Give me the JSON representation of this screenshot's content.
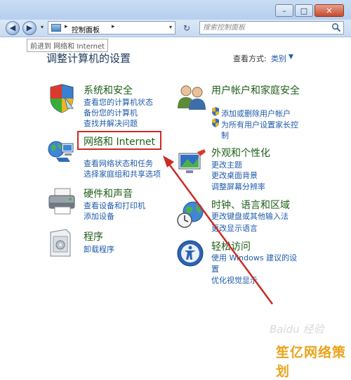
{
  "window": {
    "minimize": "–",
    "maximize": "□",
    "close": "✕"
  },
  "nav": {
    "back": "◀",
    "forward": "▶",
    "dropdown": "▾",
    "address_segment": "控制面板",
    "address_sep": "▸",
    "refresh": "↻",
    "search_placeholder": "搜索控制面板"
  },
  "tooltip": "前进到 网络和 Internet",
  "heading": "调整计算机的设置",
  "view": {
    "label": "查看方式:",
    "value": "类别",
    "arrow": "▼"
  },
  "categories": {
    "system": {
      "title": "系统和安全",
      "links": [
        "查看您的计算机状态",
        "备份您的计算机",
        "查找并解决问题"
      ]
    },
    "network": {
      "title": "网络和 Internet",
      "links": [
        "查看网络状态和任务",
        "选择家庭组和共享选项"
      ]
    },
    "hardware": {
      "title": "硬件和声音",
      "links": [
        "查看设备和打印机",
        "添加设备"
      ]
    },
    "programs": {
      "title": "程序",
      "links": [
        "卸载程序"
      ]
    },
    "users": {
      "title": "用户帐户和家庭安全",
      "links": [
        "添加或删除用户帐户",
        "为所有用户设置家长控",
        "制"
      ]
    },
    "appearance": {
      "title": "外观和个性化",
      "links": [
        "更改主题",
        "更改桌面背景",
        "调整屏幕分辨率"
      ]
    },
    "clock": {
      "title": "时钟、语言和区域",
      "links": [
        "更改键盘或其他输入法",
        "更改显示语言"
      ]
    },
    "ease": {
      "title": "轻松访问",
      "links": [
        "使用 Windows 建议的设",
        "置",
        "优化视觉显示"
      ]
    }
  },
  "overlay": {
    "watermark": "Baidu 经验",
    "brand": "笙亿网络策划"
  },
  "colors": {
    "highlight_box": "#cc2b25",
    "arrow": "#cc2b25",
    "category_title": "#1e5f17",
    "link": "#1f5bab"
  }
}
